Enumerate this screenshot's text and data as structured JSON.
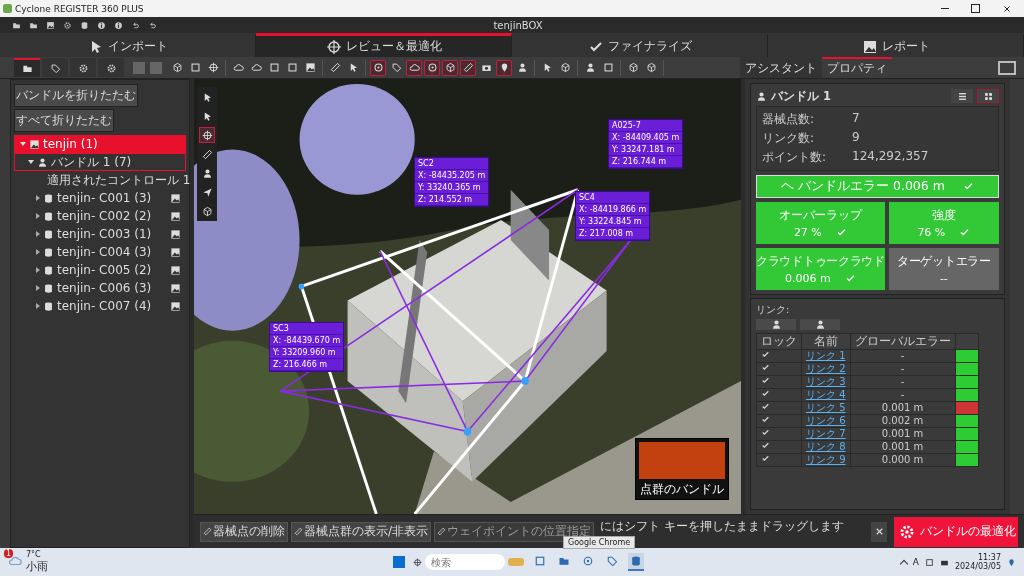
{
  "window": {
    "title": "Cyclone REGISTER 360 PLUS",
    "project": "tenjinBOX"
  },
  "workflow": [
    {
      "label": "インポート",
      "selected": false
    },
    {
      "label": "レビュー＆最適化",
      "selected": true
    },
    {
      "label": "ファイナライズ",
      "selected": false
    },
    {
      "label": "レポート",
      "selected": false
    }
  ],
  "left_tabs": [
    {
      "selected": true
    },
    {
      "selected": false
    },
    {
      "selected": false
    },
    {
      "selected": false
    }
  ],
  "toolbar": [
    [
      {
        "on": false
      },
      {
        "on": false
      },
      {
        "on": false
      }
    ],
    [
      {
        "on": false
      },
      {
        "on": false
      },
      {
        "on": false
      },
      {
        "on": false
      },
      {
        "on": false
      }
    ],
    [
      {
        "on": false
      },
      {
        "on": false
      }
    ],
    [
      {
        "on": true
      },
      {
        "on": false
      },
      {
        "on": true
      },
      {
        "on": true
      },
      {
        "on": true
      },
      {
        "on": true
      },
      {
        "on": false
      },
      {
        "on": true
      },
      {
        "on": false
      }
    ],
    [
      {
        "on": false
      },
      {
        "on": false
      }
    ],
    [
      {
        "on": false
      },
      {
        "on": false
      }
    ],
    [
      {
        "on": false
      },
      {
        "on": false
      }
    ]
  ],
  "right_tabs": [
    {
      "label": "アシスタント",
      "selected": false
    },
    {
      "label": "プロパティ",
      "selected": true
    }
  ],
  "tree_buttons": [
    "バンドルを折りたたむ",
    "すべて折りたたむ"
  ],
  "tree": [
    {
      "kind": "project",
      "label": "tenjin (1)",
      "selected": true,
      "highlighted": false,
      "expanded": true,
      "children": [
        {
          "kind": "bundle",
          "label": "バンドル 1 (7)",
          "selected": false,
          "highlighted": true,
          "expanded": true,
          "children": [
            {
              "kind": "controls",
              "label": "適用されたコントロール 1",
              "selected": false,
              "highlighted": false
            },
            {
              "kind": "setup",
              "label": "tenjin- C001 (3)",
              "selected": false,
              "highlighted": false,
              "expanded": false
            },
            {
              "kind": "setup",
              "label": "tenjin- C002 (2)",
              "selected": false,
              "highlighted": false,
              "expanded": false
            },
            {
              "kind": "setup",
              "label": "tenjin- C003 (1)",
              "selected": false,
              "highlighted": false,
              "expanded": false
            },
            {
              "kind": "setup",
              "label": "tenjin- C004 (3)",
              "selected": false,
              "highlighted": false,
              "expanded": false
            },
            {
              "kind": "setup",
              "label": "tenjin- C005 (2)",
              "selected": false,
              "highlighted": false,
              "expanded": false
            },
            {
              "kind": "setup",
              "label": "tenjin- C006 (3)",
              "selected": false,
              "highlighted": false,
              "expanded": false
            },
            {
              "kind": "setup",
              "label": "tenjin- C007 (4)",
              "selected": false,
              "highlighted": false,
              "expanded": false
            }
          ]
        }
      ]
    }
  ],
  "viewport_tools": [
    {
      "on": false
    },
    {
      "on": false
    },
    {
      "on": true
    },
    {
      "on": false
    },
    {
      "on": false
    },
    {
      "on": false
    },
    {
      "on": false
    }
  ],
  "targets": [
    {
      "name": "SC2",
      "x": "X: -84435.205 m",
      "y": "Y: 33240.365 m",
      "z": "Z: 214.552 m"
    },
    {
      "name": "A025-7",
      "x": "X: -84409.405 m",
      "y": "Y: 33247.181 m",
      "z": "Z: 216.744 m"
    },
    {
      "name": "SC4",
      "x": "X: -84419.866 m",
      "y": "Y: 33224.845 m",
      "z": "Z: 217.008 m"
    },
    {
      "name": "SC3",
      "x": "X: -84439.670 m",
      "y": "Y: 33209.960 m",
      "z": "Z: 216.466 m"
    }
  ],
  "thumbnail": {
    "caption": "点群のバンドル"
  },
  "bottom_bar": {
    "buttons": [
      {
        "label": "器械点の削除",
        "disabled": false
      },
      {
        "label": "器械点群の表示/非表示",
        "disabled": false
      },
      {
        "label": "ウェイポイントの位置指定",
        "disabled": true
      }
    ],
    "hint": "にはシフト キーを押したままドラッグします",
    "optimize": "バンドルの最適化"
  },
  "properties": {
    "title": "バンドル 1",
    "views": [
      {
        "selected": false
      },
      {
        "selected": true
      }
    ],
    "stats": [
      {
        "label": "器械点数:",
        "value": "7"
      },
      {
        "label": "リンク数:",
        "value": "9"
      },
      {
        "label": "ポイント数:",
        "value": "124,292,357"
      }
    ],
    "bundle_error": {
      "label": "ヘ バンドルエラー 0.006 m",
      "ok": true
    },
    "tiles": [
      {
        "label": "オーバーラップ",
        "value": "27 %",
        "ok": true
      },
      {
        "label": "強度",
        "value": "76 %",
        "ok": true
      },
      {
        "label": "クラウドトゥークラウド",
        "value": "0.006 m",
        "ok": true
      },
      {
        "label": "ターゲットエラー",
        "value": "--",
        "ok": false
      }
    ]
  },
  "links": {
    "title": "リンク:",
    "columns": [
      "ロック",
      "名前",
      "グローバルエラー"
    ],
    "rows": [
      {
        "locked": true,
        "name": "リンク 1",
        "error": "-",
        "color": "#2ecc34"
      },
      {
        "locked": true,
        "name": "リンク 2",
        "error": "-",
        "color": "#2ecc34"
      },
      {
        "locked": true,
        "name": "リンク 3",
        "error": "-",
        "color": "#2ecc34"
      },
      {
        "locked": true,
        "name": "リンク 4",
        "error": "-",
        "color": "#2ecc34"
      },
      {
        "locked": true,
        "name": "リンク 5",
        "error": "0.001 m",
        "color": "#d03434"
      },
      {
        "locked": true,
        "name": "リンク 6",
        "error": "0.002 m",
        "color": "#2ecc34"
      },
      {
        "locked": true,
        "name": "リンク 7",
        "error": "0.001 m",
        "color": "#2ecc34"
      },
      {
        "locked": true,
        "name": "リンク 8",
        "error": "0.001 m",
        "color": "#2ecc34"
      },
      {
        "locked": true,
        "name": "リンク 9",
        "error": "0.000 m",
        "color": "#2ecc34"
      }
    ]
  },
  "taskbar": {
    "temperature": "7°C",
    "weather": "小雨",
    "badge": "1",
    "search_placeholder": "検索",
    "tooltip": "Google Chrome",
    "apps": [
      {
        "selected": false
      },
      {
        "selected": false
      },
      {
        "selected": false
      },
      {
        "selected": false
      },
      {
        "selected": true
      }
    ],
    "tray_letter": "A",
    "time": "11:37",
    "date": "2024/03/05"
  }
}
